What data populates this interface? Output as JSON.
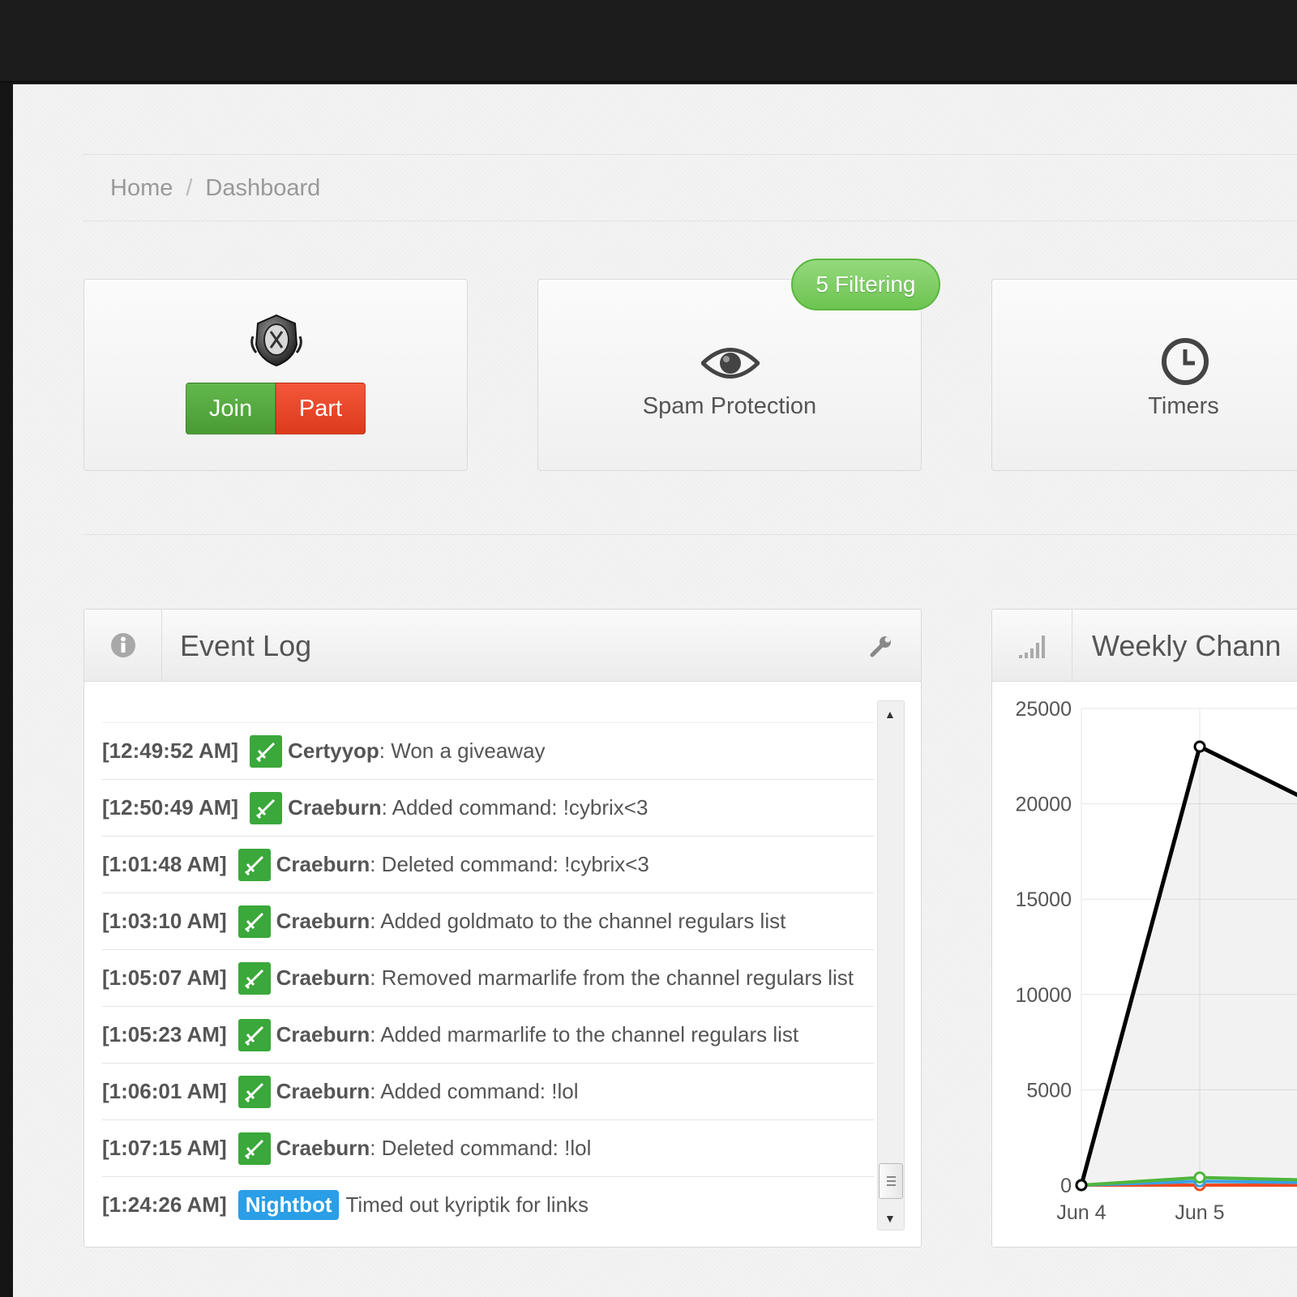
{
  "breadcrumb": {
    "home": "Home",
    "separator": "/",
    "current": "Dashboard"
  },
  "tiles": {
    "bot": {
      "join_label": "Join",
      "part_label": "Part",
      "icon": "bot-shield-icon"
    },
    "spam": {
      "label": "Spam Protection",
      "badge": "5 Filtering",
      "icon": "eye-icon"
    },
    "timers": {
      "label": "Timers",
      "icon": "clock-icon"
    }
  },
  "event_log": {
    "title": "Event Log",
    "entries": [
      {
        "time": "[12:49:52 AM]",
        "user": "Certyyop",
        "text": ": Won a giveaway",
        "type": "mod"
      },
      {
        "time": "[12:50:49 AM]",
        "user": "Craeburn",
        "text": ": Added command: !cybrix<3",
        "type": "mod"
      },
      {
        "time": "[1:01:48 AM]",
        "user": "Craeburn",
        "text": ": Deleted command: !cybrix<3",
        "type": "mod"
      },
      {
        "time": "[1:03:10 AM]",
        "user": "Craeburn",
        "text": ": Added goldmato to the channel regulars list",
        "type": "mod"
      },
      {
        "time": "[1:05:07 AM]",
        "user": "Craeburn",
        "text": ": Removed marmarlife from the channel regulars list",
        "type": "mod"
      },
      {
        "time": "[1:05:23 AM]",
        "user": "Craeburn",
        "text": ": Added marmarlife to the channel regulars list",
        "type": "mod"
      },
      {
        "time": "[1:06:01 AM]",
        "user": "Craeburn",
        "text": ": Added command: !lol",
        "type": "mod"
      },
      {
        "time": "[1:07:15 AM]",
        "user": "Craeburn",
        "text": ": Deleted command: !lol",
        "type": "mod"
      },
      {
        "time": "[1:24:26 AM]",
        "user": "Nightbot",
        "text": "Timed out kyriptik for links",
        "type": "bot"
      }
    ]
  },
  "weekly": {
    "title": "Weekly Chann"
  },
  "chart_data": {
    "type": "line",
    "categories": [
      "Jun 4",
      "Jun 5"
    ],
    "series": [
      {
        "values": [
          0,
          23000
        ],
        "color": "#000000"
      },
      {
        "values": [
          0,
          400
        ],
        "color": "#4fb63c"
      },
      {
        "values": [
          0,
          200
        ],
        "color": "#3aa0e6"
      },
      {
        "values": [
          0,
          0
        ],
        "color": "#f04a22"
      }
    ],
    "yticks": [
      "25000",
      "20000",
      "15000",
      "10000",
      "5000",
      "0"
    ],
    "ylim": [
      0,
      25000
    ],
    "grid": true
  }
}
